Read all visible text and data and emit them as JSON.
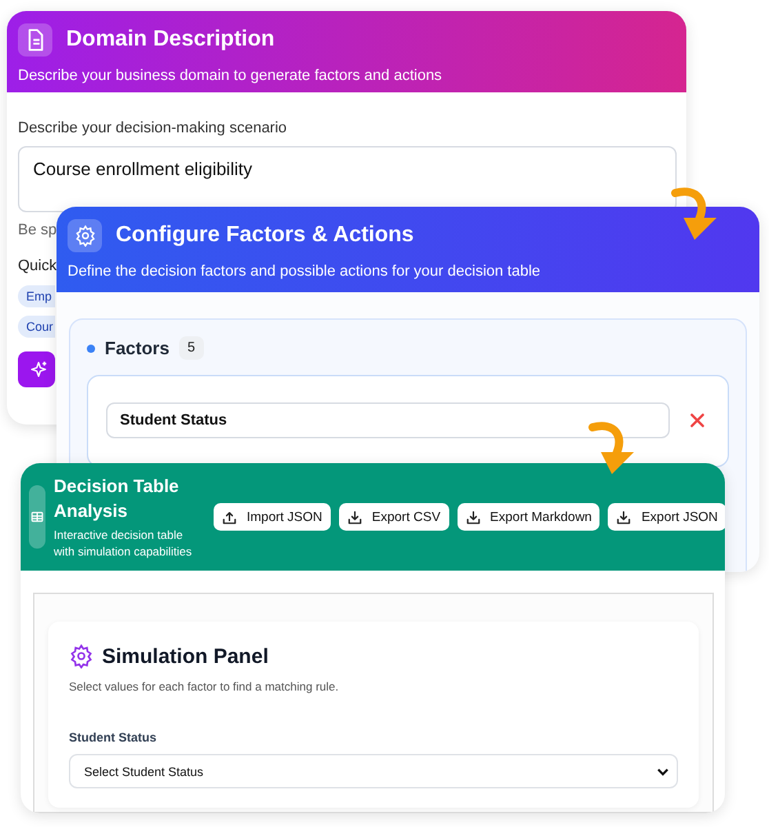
{
  "cards": [
    {
      "kind": "domain",
      "title": "Domain Description",
      "subtitle": "Describe your business domain to generate factors and actions",
      "field_label": "Describe your decision-making scenario",
      "scenario": "Course enrollment eligibility",
      "hint": "Be sp",
      "quick_label": "Quick",
      "chips": [
        "Emp",
        "Cour"
      ]
    },
    {
      "kind": "factors",
      "title": "Configure Factors & Actions",
      "subtitle": "Define the decision factors and possible actions for your decision table",
      "section": {
        "title": "Factors",
        "count": "5",
        "factors": [
          {
            "name": "Student Status"
          }
        ]
      }
    },
    {
      "kind": "analysis",
      "title": "Decision Table Analysis",
      "subtitle": "Interactive decision table with simulation capabilities",
      "buttons": [
        {
          "label": "Import JSON",
          "kind": "import"
        },
        {
          "label": "Export CSV",
          "kind": "export"
        },
        {
          "label": "Export Markdown",
          "kind": "export"
        },
        {
          "label": "Export JSON",
          "kind": "export"
        }
      ],
      "panel": {
        "title": "Simulation Panel",
        "subtitle": "Select values for each factor to find a matching rule.",
        "fields": [
          {
            "label": "Student Status",
            "value": "Select Student Status"
          }
        ]
      }
    }
  ]
}
